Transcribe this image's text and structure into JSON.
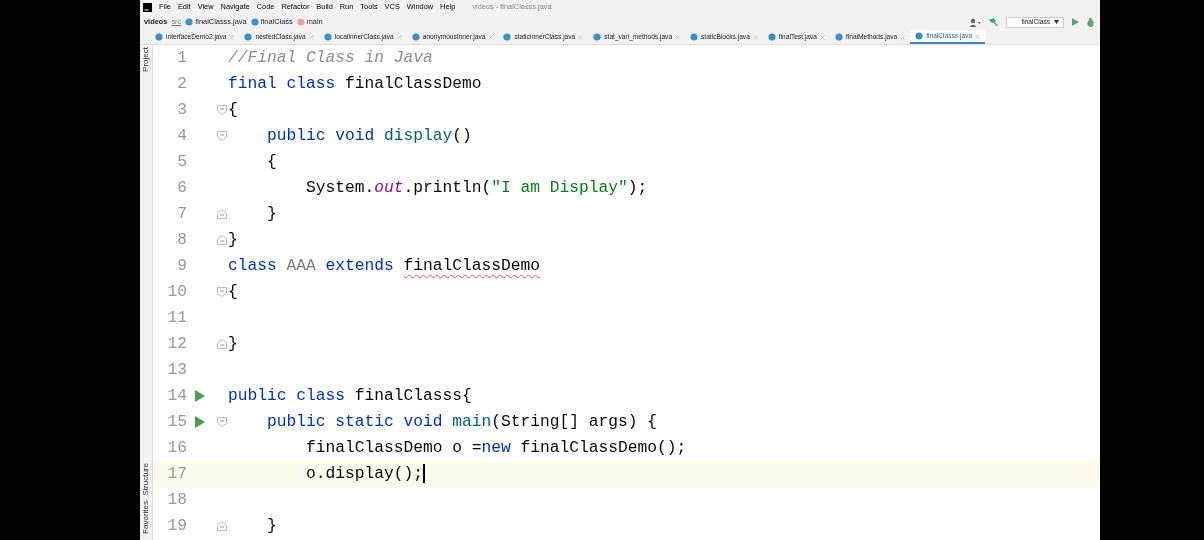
{
  "menu": [
    "File",
    "Edit",
    "View",
    "Navigate",
    "Code",
    "Refactor",
    "Build",
    "Run",
    "Tools",
    "VCS",
    "Window",
    "Help"
  ],
  "window": {
    "title": "videos - finalClasss.java"
  },
  "breadcrumb": [
    {
      "text": "videos",
      "kind": "project"
    },
    {
      "text": "src",
      "kind": "folder"
    },
    {
      "text": "finalClasss.java",
      "kind": "file"
    },
    {
      "text": "finalClass",
      "kind": "class"
    },
    {
      "text": "main",
      "kind": "method"
    }
  ],
  "run_config": "finalClass",
  "tabs": [
    {
      "label": "interfaceDemo2.java",
      "selected": false
    },
    {
      "label": "nestedClass.java",
      "selected": false
    },
    {
      "label": "localInnerClass.java",
      "selected": false
    },
    {
      "label": "anonymousInner.java",
      "selected": false
    },
    {
      "label": "staticInnerClass.java",
      "selected": false
    },
    {
      "label": "stat_vari_methods.java",
      "selected": false
    },
    {
      "label": "staticBlocks.java",
      "selected": false
    },
    {
      "label": "finalTest.java",
      "selected": false
    },
    {
      "label": "finalMethods.java",
      "selected": false
    },
    {
      "label": "finalClasss.java",
      "selected": true
    }
  ],
  "side_tools_top": [
    "Project"
  ],
  "side_tools_bottom": [
    "Structure",
    "Favorites"
  ],
  "lines": [
    {
      "number": "1",
      "tokens": [
        {
          "kind": "comment",
          "text": "//Final Class in Java"
        }
      ]
    },
    {
      "number": "2",
      "tokens": [
        {
          "kind": "keyword",
          "text": "final class "
        },
        {
          "kind": "plain",
          "text": "finalClassDemo"
        }
      ]
    },
    {
      "number": "3",
      "fold_start": true,
      "tokens": [
        {
          "kind": "plain",
          "text": "{"
        }
      ]
    },
    {
      "number": "4",
      "fold_start": true,
      "tokens": [
        {
          "kind": "keyword",
          "text": "    public void "
        },
        {
          "kind": "method",
          "text": "display"
        },
        {
          "kind": "plain",
          "text": "()"
        }
      ]
    },
    {
      "number": "5",
      "tokens": [
        {
          "kind": "plain",
          "text": "    {"
        }
      ]
    },
    {
      "number": "6",
      "tokens": [
        {
          "kind": "plain",
          "text": "        System."
        },
        {
          "kind": "field",
          "text": "out"
        },
        {
          "kind": "plain",
          "text": ".println("
        },
        {
          "kind": "string",
          "text": "\"I am Display\""
        },
        {
          "kind": "plain",
          "text": ");"
        }
      ]
    },
    {
      "number": "7",
      "fold_end": true,
      "tokens": [
        {
          "kind": "plain",
          "text": "    }"
        }
      ]
    },
    {
      "number": "8",
      "fold_end": true,
      "tokens": [
        {
          "kind": "plain",
          "text": "}"
        }
      ]
    },
    {
      "number": "9",
      "tokens": [
        {
          "kind": "keyword",
          "text": "class "
        },
        {
          "kind": "unused",
          "text": "AAA"
        },
        {
          "kind": "keyword",
          "text": " extends "
        },
        {
          "kind": "error",
          "text": "finalClassDemo"
        }
      ]
    },
    {
      "number": "10",
      "fold_start": true,
      "tokens": [
        {
          "kind": "plain",
          "text": "{"
        }
      ]
    },
    {
      "number": "11"
    },
    {
      "number": "12",
      "fold_end": true,
      "tokens": [
        {
          "kind": "plain",
          "text": "}"
        }
      ]
    },
    {
      "number": "13"
    },
    {
      "number": "14",
      "run": true,
      "tokens": [
        {
          "kind": "keyword",
          "text": "public class "
        },
        {
          "kind": "plain",
          "text": "finalClasss{"
        }
      ]
    },
    {
      "number": "15",
      "run": true,
      "fold_start": true,
      "tokens": [
        {
          "kind": "keyword",
          "text": "    public static void "
        },
        {
          "kind": "method",
          "text": "main"
        },
        {
          "kind": "plain",
          "text": "(String[] args) {"
        }
      ]
    },
    {
      "number": "16",
      "tokens": [
        {
          "kind": "plain",
          "text": "        finalClassDemo o ="
        },
        {
          "kind": "keyword",
          "text": "new "
        },
        {
          "kind": "plain",
          "text": "finalClassDemo();"
        }
      ]
    },
    {
      "number": "17",
      "current": true,
      "tokens": [
        {
          "kind": "plain",
          "text": "        o.display();"
        }
      ]
    },
    {
      "number": "18"
    },
    {
      "number": "19",
      "fold_end": true,
      "tokens": [
        {
          "kind": "plain",
          "text": "    }"
        }
      ]
    }
  ]
}
